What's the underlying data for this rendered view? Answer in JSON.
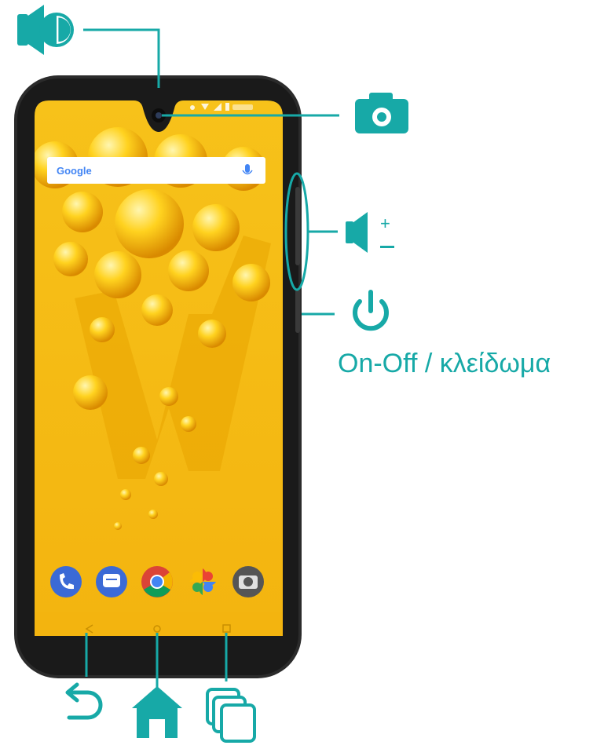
{
  "accent_color": "#17a9a7",
  "caption": {
    "power_label": "On-Off / κλείδωμα"
  },
  "search_widget": {
    "brand": "Google"
  },
  "callouts": [
    {
      "id": "speaker",
      "icon": "speaker-icon"
    },
    {
      "id": "camera",
      "icon": "camera-icon"
    },
    {
      "id": "volume",
      "icon": "volume-up-down-icon"
    },
    {
      "id": "power",
      "icon": "power-icon"
    },
    {
      "id": "back",
      "icon": "back-arrow-icon"
    },
    {
      "id": "home",
      "icon": "home-icon"
    },
    {
      "id": "recent-apps",
      "icon": "recent-apps-icon"
    }
  ],
  "dock_apps": [
    {
      "name": "phone",
      "icon": "phone-app-icon",
      "color": "#3b6ad6"
    },
    {
      "name": "messages",
      "icon": "messages-app-icon",
      "color": "#3b6ad6"
    },
    {
      "name": "chrome",
      "icon": "chrome-app-icon",
      "color": "#db4437"
    },
    {
      "name": "photos",
      "icon": "photos-app-icon",
      "color": "#f4b400"
    },
    {
      "name": "camera",
      "icon": "camera-app-icon",
      "color": "#555555"
    }
  ]
}
